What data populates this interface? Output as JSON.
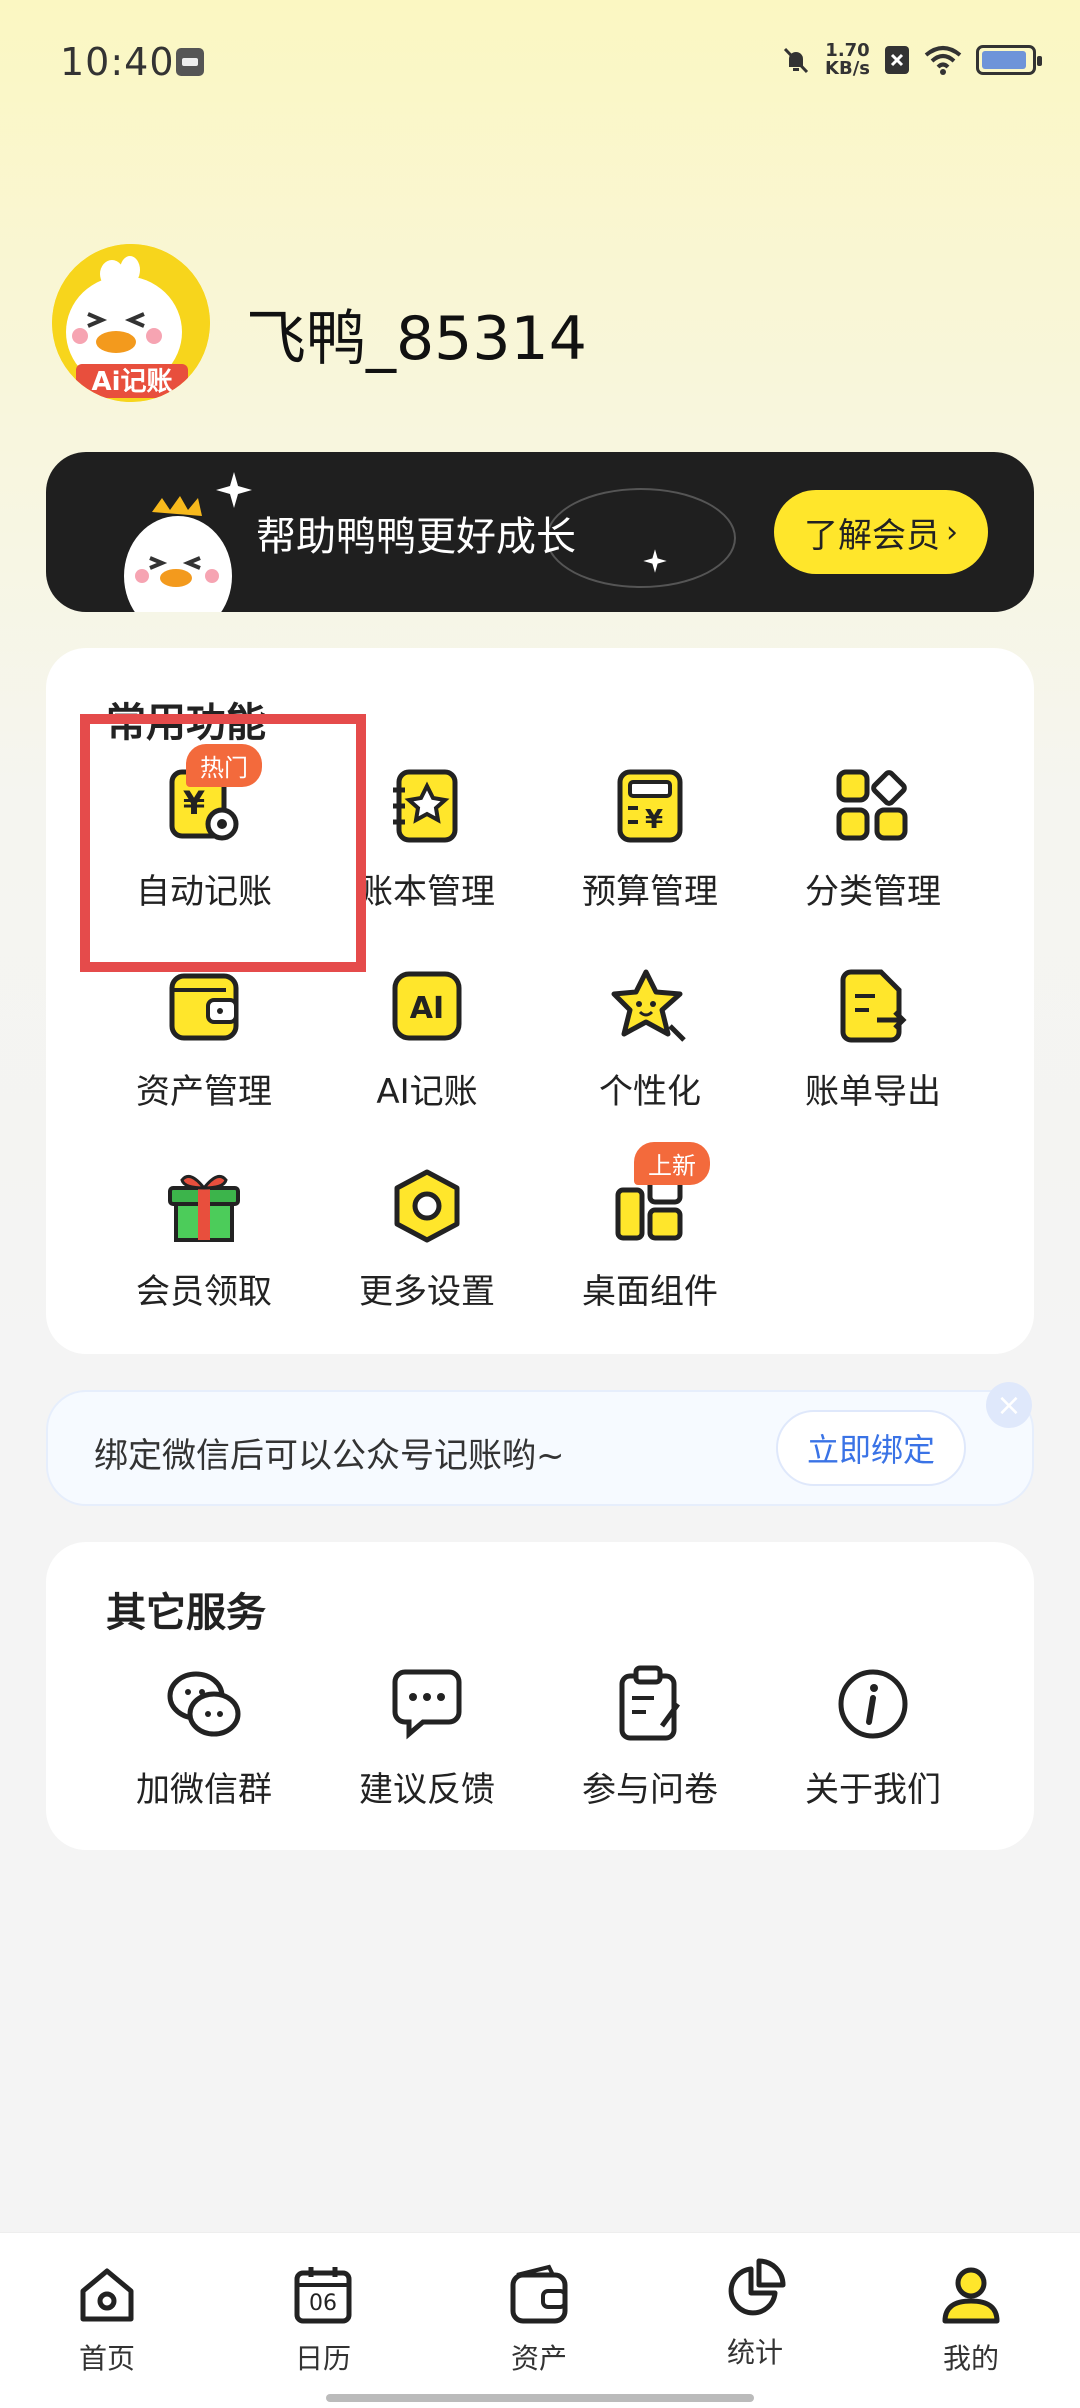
{
  "status_bar": {
    "time": "10:40",
    "net_speed_value": "1.70",
    "net_speed_unit": "KB/s"
  },
  "profile": {
    "username": "飞鸭_85314",
    "avatar_badge": "Ai记账"
  },
  "vip_banner": {
    "text": "帮助鸭鸭更好成长",
    "button_label": "了解会员"
  },
  "common_features": {
    "title": "常用功能",
    "items": [
      {
        "label": "自动记账",
        "icon": "auto-bookkeeping-icon",
        "tag": "热门"
      },
      {
        "label": "账本管理",
        "icon": "ledger-icon"
      },
      {
        "label": "预算管理",
        "icon": "budget-icon"
      },
      {
        "label": "分类管理",
        "icon": "category-icon"
      },
      {
        "label": "资产管理",
        "icon": "wallet-icon"
      },
      {
        "label": "AI记账",
        "icon": "ai-icon"
      },
      {
        "label": "个性化",
        "icon": "star-face-icon"
      },
      {
        "label": "账单导出",
        "icon": "export-icon"
      },
      {
        "label": "会员领取",
        "icon": "gift-icon"
      },
      {
        "label": "更多设置",
        "icon": "settings-hex-icon"
      },
      {
        "label": "桌面组件",
        "icon": "widget-icon",
        "tag": "上新"
      }
    ]
  },
  "wechat_bind": {
    "message": "绑定微信后可以公众号记账哟~",
    "button_label": "立即绑定",
    "close": "×"
  },
  "other_services": {
    "title": "其它服务",
    "items": [
      {
        "label": "加微信群",
        "icon": "wechat-icon"
      },
      {
        "label": "建议反馈",
        "icon": "chat-bubble-icon"
      },
      {
        "label": "参与问卷",
        "icon": "clipboard-icon"
      },
      {
        "label": "关于我们",
        "icon": "info-icon"
      }
    ]
  },
  "tab_bar": {
    "calendar_day": "06",
    "items": [
      {
        "label": "首页",
        "icon": "home-icon"
      },
      {
        "label": "日历",
        "icon": "calendar-icon"
      },
      {
        "label": "资产",
        "icon": "wallet-icon"
      },
      {
        "label": "统计",
        "icon": "pie-chart-icon"
      },
      {
        "label": "我的",
        "icon": "user-icon"
      }
    ]
  },
  "colors": {
    "accent_yellow": "#ffe62b",
    "dark": "#222222",
    "tag_orange": "#f36a3c",
    "link_blue": "#3a73e6",
    "highlight_red": "#e54b4b"
  }
}
